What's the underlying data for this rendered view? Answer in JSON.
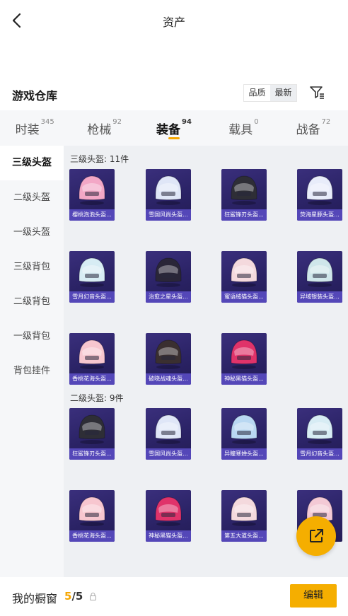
{
  "header": {
    "title": "资产"
  },
  "warehouse": {
    "title": "游戏仓库",
    "sort_quality": "品质",
    "sort_latest": "最新"
  },
  "tabs": [
    {
      "label": "时装",
      "count": "345"
    },
    {
      "label": "枪械",
      "count": "92"
    },
    {
      "label": "装备",
      "count": "94",
      "active": true
    },
    {
      "label": "载具",
      "count": "0"
    },
    {
      "label": "战备",
      "count": "72"
    }
  ],
  "sidebar": {
    "items": [
      {
        "label": "三级头盔",
        "active": true
      },
      {
        "label": "二级头盔"
      },
      {
        "label": "一级头盔"
      },
      {
        "label": "三级背包"
      },
      {
        "label": "二级背包"
      },
      {
        "label": "一级背包"
      },
      {
        "label": "背包挂件"
      }
    ]
  },
  "sections": [
    {
      "heading": "三级头盔: 11件",
      "items": [
        {
          "name": "樱桃泡泡头盔...",
          "color": "#f3a7c6"
        },
        {
          "name": "雪国风尚头盔...",
          "color": "#dfe6f7"
        },
        {
          "name": "狂鲨锋刃头盔...",
          "color": "#2e2e36"
        },
        {
          "name": "荧海星豚头盔...",
          "color": "#e8ecfa"
        },
        {
          "name": "雪月幻音头盔...",
          "color": "#d7ecf4"
        },
        {
          "name": "治愈之星头盔...",
          "color": "#2a2638"
        },
        {
          "name": "蜜语绒猫头盔...",
          "color": "#f4d9dd"
        },
        {
          "name": "异域银装头盔...",
          "color": "#cfe6ea"
        },
        {
          "name": "香桃花海头盔...",
          "color": "#f7c6cf"
        },
        {
          "name": "破晓战魂头盔...",
          "color": "#3a2f30"
        },
        {
          "name": "神秘黑猫头盔...",
          "color": "#e0336a"
        }
      ]
    },
    {
      "heading": "二级头盔: 9件",
      "items": [
        {
          "name": "狂鲨锋刃头盔...",
          "color": "#2e2e36"
        },
        {
          "name": "雪国风尚头盔...",
          "color": "#dfe6f7"
        },
        {
          "name": "异瞳寒婵头盔...",
          "color": "#b9d8f2"
        },
        {
          "name": "雪月幻音头盔...",
          "color": "#d7ecf4"
        },
        {
          "name": "香桃花海头盔...",
          "color": "#f7c6cf"
        },
        {
          "name": "神秘黑猫头盔...",
          "color": "#e0336a"
        },
        {
          "name": "第五大道头盔...",
          "color": "#f4d9dd"
        },
        {
          "name": "",
          "color": "#f3c9d5"
        }
      ]
    }
  ],
  "bottom": {
    "showcase_label": "我的橱窗",
    "current": "5",
    "separator": "/",
    "total": "5",
    "edit_label": "编辑"
  },
  "colors": {
    "accent": "#f5ae00",
    "card_bg": "#2b2366",
    "card_label_bg": "#5447b8"
  }
}
